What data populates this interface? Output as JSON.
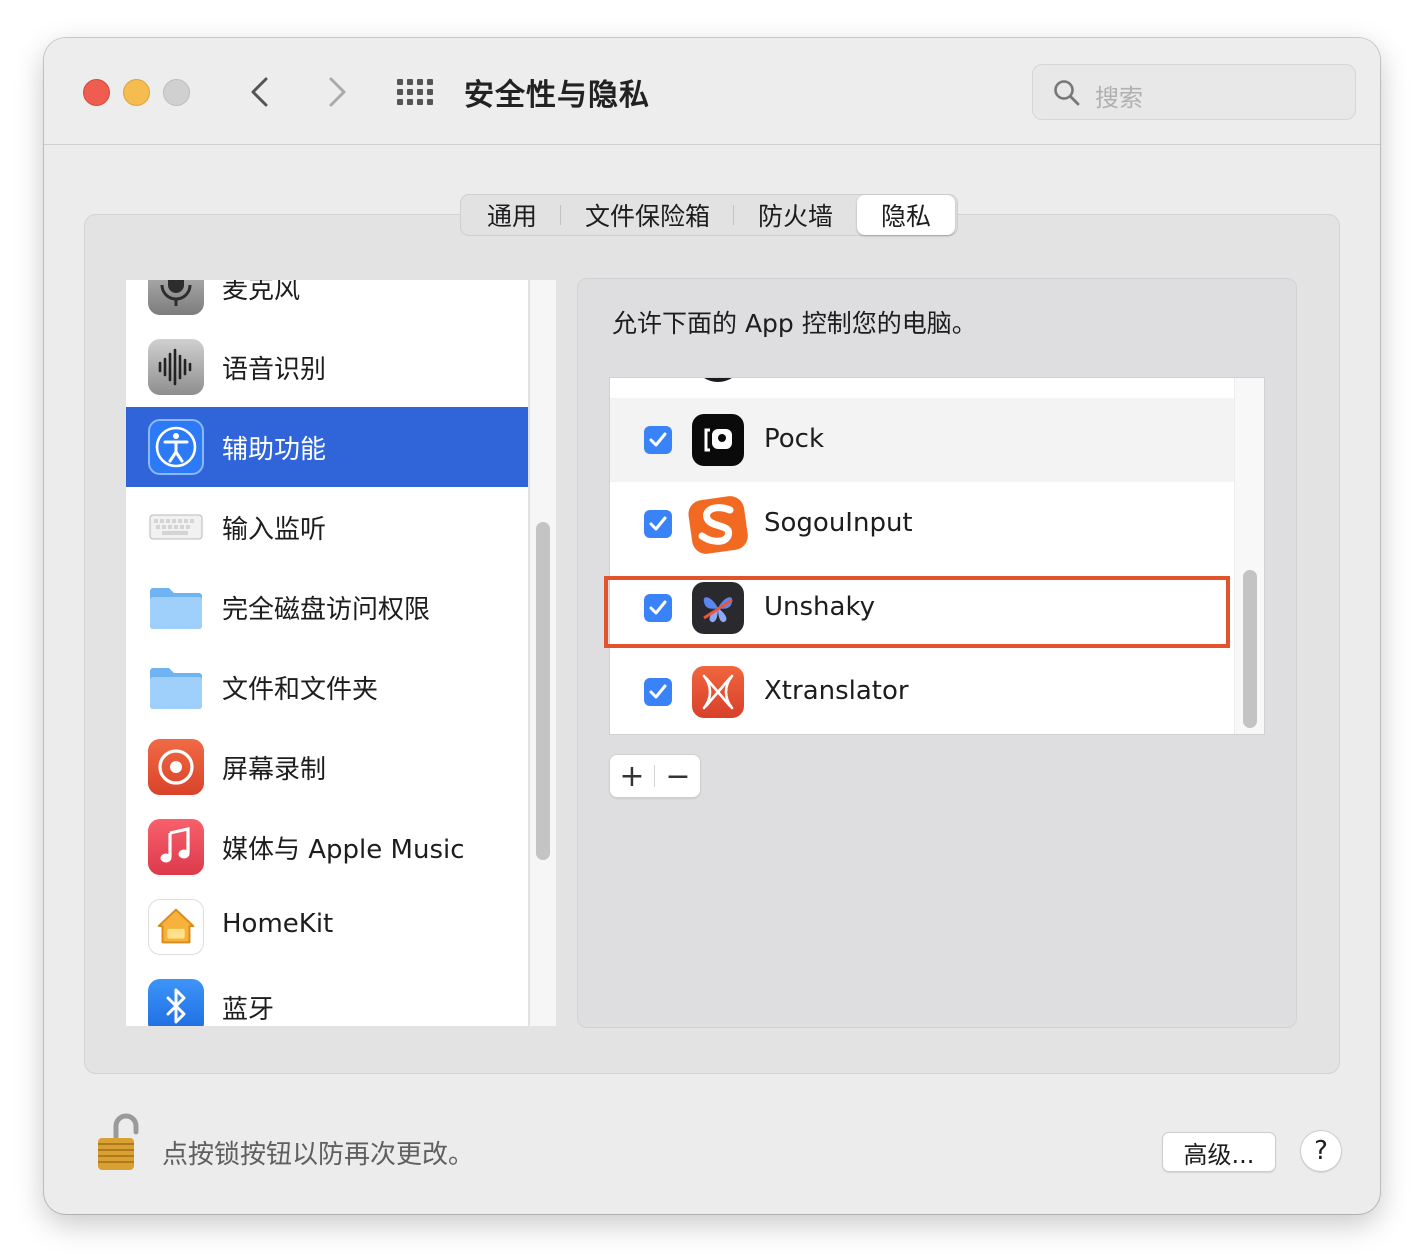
{
  "window": {
    "title": "安全性与隐私",
    "search_placeholder": "搜索"
  },
  "tabs": [
    {
      "label": "通用",
      "active": false
    },
    {
      "label": "文件保险箱",
      "active": false
    },
    {
      "label": "防火墙",
      "active": false
    },
    {
      "label": "隐私",
      "active": true
    }
  ],
  "sidebar": {
    "items": [
      {
        "label": "麦克风",
        "icon": "microphone-icon"
      },
      {
        "label": "语音识别",
        "icon": "waveform-icon"
      },
      {
        "label": "辅助功能",
        "icon": "accessibility-icon",
        "selected": true
      },
      {
        "label": "输入监听",
        "icon": "keyboard-icon"
      },
      {
        "label": "完全磁盘访问权限",
        "icon": "folder-icon"
      },
      {
        "label": "文件和文件夹",
        "icon": "folder-icon"
      },
      {
        "label": "屏幕录制",
        "icon": "screen-record-icon"
      },
      {
        "label": "媒体与 Apple Music",
        "icon": "music-note-icon"
      },
      {
        "label": "HomeKit",
        "icon": "home-icon"
      },
      {
        "label": "蓝牙",
        "icon": "bluetooth-icon"
      }
    ]
  },
  "main": {
    "description": "允许下面的 App 控制您的电脑。",
    "apps": [
      {
        "name": "Pock",
        "checked": true,
        "icon": "pock-app-icon"
      },
      {
        "name": "SogouInput",
        "checked": true,
        "icon": "sogou-app-icon"
      },
      {
        "name": "Unshaky",
        "checked": true,
        "icon": "unshaky-app-icon",
        "highlighted": true
      },
      {
        "name": "Xtranslator",
        "checked": true,
        "icon": "xtranslator-app-icon"
      }
    ],
    "add_label": "+",
    "remove_label": "−"
  },
  "footer": {
    "lock_text": "点按锁按钮以防再次更改。",
    "advanced_label": "高级...",
    "help_label": "?"
  },
  "colors": {
    "selection": "#2f65d9",
    "checkbox": "#3a82f7",
    "highlight_box": "#e0532d"
  }
}
